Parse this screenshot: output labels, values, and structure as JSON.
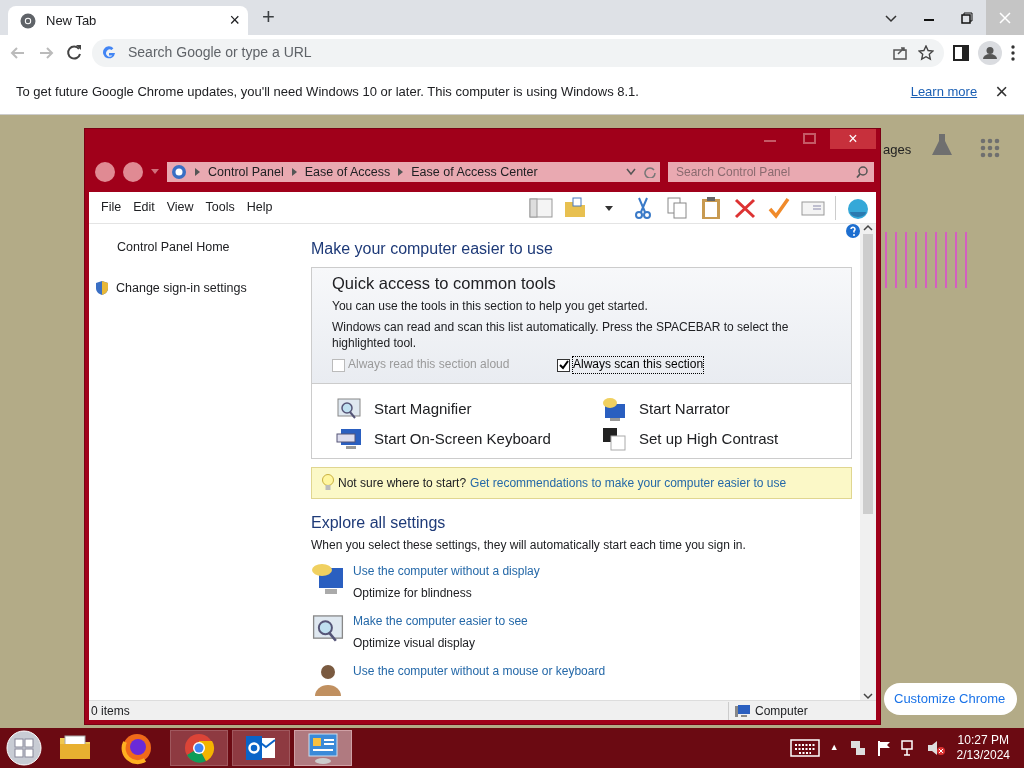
{
  "chrome": {
    "tab": {
      "title": "New Tab",
      "close": "×"
    },
    "new_tab_button": "+",
    "omnibox": {
      "placeholder": "Search Google or type a URL"
    },
    "infobar": {
      "message": "To get future Google Chrome updates, you'll need Windows 10 or later. This computer is using Windows 8.1.",
      "link": "Learn more",
      "close": "×"
    }
  },
  "page_behind": {
    "images_link": "ages",
    "customize_button": "Customize Chrome"
  },
  "cp_window": {
    "close": "×",
    "breadcrumb": [
      "Control Panel",
      "Ease of Access",
      "Ease of Access Center"
    ],
    "search": {
      "placeholder": "Search Control Panel"
    },
    "menu": [
      "File",
      "Edit",
      "View",
      "Tools",
      "Help"
    ],
    "sidebar": [
      {
        "label": "Control Panel Home",
        "kind": "link"
      },
      {
        "label": "Change sign-in settings",
        "kind": "shield"
      }
    ],
    "heading": "Make your computer easier to use",
    "quick": {
      "title": "Quick access to common tools",
      "intro": "You can use the tools in this section to help you get started.",
      "scan_text": "Windows can read and scan this list automatically.  Press the SPACEBAR to select the highlighted tool.",
      "options": [
        {
          "label": "Always read this section aloud",
          "checked": false,
          "disabled": true
        },
        {
          "label": "Always scan this section",
          "checked": true,
          "disabled": false
        }
      ],
      "tools": [
        {
          "label": "Start Magnifier",
          "kind": "magnifier"
        },
        {
          "label": "Start Narrator",
          "kind": "narrator"
        },
        {
          "label": "Start On-Screen Keyboard",
          "kind": "keyboard"
        },
        {
          "label": "Set up High Contrast",
          "kind": "contrast"
        }
      ]
    },
    "tip": {
      "text": "Not sure where to start?",
      "link": "Get recommendations to make your computer easier to use"
    },
    "explore": {
      "title": "Explore all settings",
      "intro": "When you select these settings, they will automatically start each time you sign in.",
      "items": [
        {
          "link": "Use the computer without a display",
          "description": "Optimize for blindness",
          "kind": "speech"
        },
        {
          "link": "Make the computer easier to see",
          "description": "Optimize visual display",
          "kind": "magnifier"
        },
        {
          "link": "Use the computer without a mouse or keyboard",
          "kind": "person"
        }
      ]
    },
    "status": {
      "count": "0 items",
      "zone": "Computer"
    }
  },
  "taskbar": {
    "apps": [
      {
        "kind": "files",
        "running": false,
        "selected": false
      },
      {
        "kind": "firefox",
        "running": false,
        "selected": false
      },
      {
        "kind": "chrome",
        "running": true,
        "selected": false
      },
      {
        "kind": "outlook",
        "running": true,
        "selected": false
      },
      {
        "kind": "controlpanel",
        "running": true,
        "selected": true
      }
    ],
    "tray_caret": "▲",
    "clock": {
      "time": "10:27 PM",
      "date": "2/13/2024"
    }
  }
}
